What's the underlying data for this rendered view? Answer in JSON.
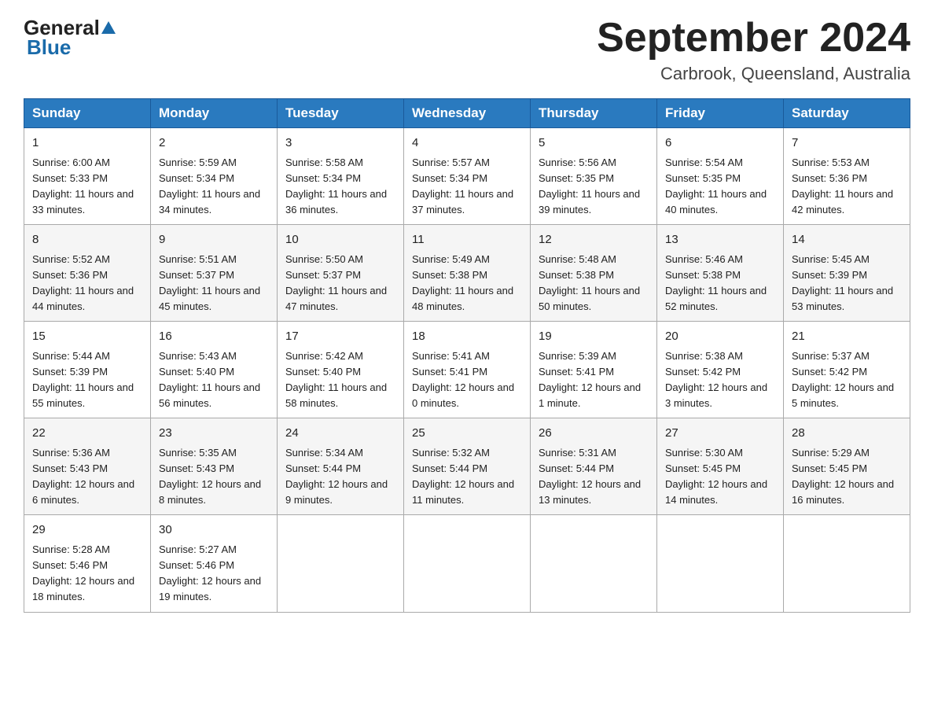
{
  "header": {
    "logo_general": "General",
    "logo_blue": "Blue",
    "month_title": "September 2024",
    "location": "Carbrook, Queensland, Australia"
  },
  "weekdays": [
    "Sunday",
    "Monday",
    "Tuesday",
    "Wednesday",
    "Thursday",
    "Friday",
    "Saturday"
  ],
  "weeks": [
    [
      {
        "day": "1",
        "sunrise": "6:00 AM",
        "sunset": "5:33 PM",
        "daylight": "11 hours and 33 minutes."
      },
      {
        "day": "2",
        "sunrise": "5:59 AM",
        "sunset": "5:34 PM",
        "daylight": "11 hours and 34 minutes."
      },
      {
        "day": "3",
        "sunrise": "5:58 AM",
        "sunset": "5:34 PM",
        "daylight": "11 hours and 36 minutes."
      },
      {
        "day": "4",
        "sunrise": "5:57 AM",
        "sunset": "5:34 PM",
        "daylight": "11 hours and 37 minutes."
      },
      {
        "day": "5",
        "sunrise": "5:56 AM",
        "sunset": "5:35 PM",
        "daylight": "11 hours and 39 minutes."
      },
      {
        "day": "6",
        "sunrise": "5:54 AM",
        "sunset": "5:35 PM",
        "daylight": "11 hours and 40 minutes."
      },
      {
        "day": "7",
        "sunrise": "5:53 AM",
        "sunset": "5:36 PM",
        "daylight": "11 hours and 42 minutes."
      }
    ],
    [
      {
        "day": "8",
        "sunrise": "5:52 AM",
        "sunset": "5:36 PM",
        "daylight": "11 hours and 44 minutes."
      },
      {
        "day": "9",
        "sunrise": "5:51 AM",
        "sunset": "5:37 PM",
        "daylight": "11 hours and 45 minutes."
      },
      {
        "day": "10",
        "sunrise": "5:50 AM",
        "sunset": "5:37 PM",
        "daylight": "11 hours and 47 minutes."
      },
      {
        "day": "11",
        "sunrise": "5:49 AM",
        "sunset": "5:38 PM",
        "daylight": "11 hours and 48 minutes."
      },
      {
        "day": "12",
        "sunrise": "5:48 AM",
        "sunset": "5:38 PM",
        "daylight": "11 hours and 50 minutes."
      },
      {
        "day": "13",
        "sunrise": "5:46 AM",
        "sunset": "5:38 PM",
        "daylight": "11 hours and 52 minutes."
      },
      {
        "day": "14",
        "sunrise": "5:45 AM",
        "sunset": "5:39 PM",
        "daylight": "11 hours and 53 minutes."
      }
    ],
    [
      {
        "day": "15",
        "sunrise": "5:44 AM",
        "sunset": "5:39 PM",
        "daylight": "11 hours and 55 minutes."
      },
      {
        "day": "16",
        "sunrise": "5:43 AM",
        "sunset": "5:40 PM",
        "daylight": "11 hours and 56 minutes."
      },
      {
        "day": "17",
        "sunrise": "5:42 AM",
        "sunset": "5:40 PM",
        "daylight": "11 hours and 58 minutes."
      },
      {
        "day": "18",
        "sunrise": "5:41 AM",
        "sunset": "5:41 PM",
        "daylight": "12 hours and 0 minutes."
      },
      {
        "day": "19",
        "sunrise": "5:39 AM",
        "sunset": "5:41 PM",
        "daylight": "12 hours and 1 minute."
      },
      {
        "day": "20",
        "sunrise": "5:38 AM",
        "sunset": "5:42 PM",
        "daylight": "12 hours and 3 minutes."
      },
      {
        "day": "21",
        "sunrise": "5:37 AM",
        "sunset": "5:42 PM",
        "daylight": "12 hours and 5 minutes."
      }
    ],
    [
      {
        "day": "22",
        "sunrise": "5:36 AM",
        "sunset": "5:43 PM",
        "daylight": "12 hours and 6 minutes."
      },
      {
        "day": "23",
        "sunrise": "5:35 AM",
        "sunset": "5:43 PM",
        "daylight": "12 hours and 8 minutes."
      },
      {
        "day": "24",
        "sunrise": "5:34 AM",
        "sunset": "5:44 PM",
        "daylight": "12 hours and 9 minutes."
      },
      {
        "day": "25",
        "sunrise": "5:32 AM",
        "sunset": "5:44 PM",
        "daylight": "12 hours and 11 minutes."
      },
      {
        "day": "26",
        "sunrise": "5:31 AM",
        "sunset": "5:44 PM",
        "daylight": "12 hours and 13 minutes."
      },
      {
        "day": "27",
        "sunrise": "5:30 AM",
        "sunset": "5:45 PM",
        "daylight": "12 hours and 14 minutes."
      },
      {
        "day": "28",
        "sunrise": "5:29 AM",
        "sunset": "5:45 PM",
        "daylight": "12 hours and 16 minutes."
      }
    ],
    [
      {
        "day": "29",
        "sunrise": "5:28 AM",
        "sunset": "5:46 PM",
        "daylight": "12 hours and 18 minutes."
      },
      {
        "day": "30",
        "sunrise": "5:27 AM",
        "sunset": "5:46 PM",
        "daylight": "12 hours and 19 minutes."
      },
      null,
      null,
      null,
      null,
      null
    ]
  ],
  "labels": {
    "sunrise": "Sunrise:",
    "sunset": "Sunset:",
    "daylight": "Daylight:"
  }
}
